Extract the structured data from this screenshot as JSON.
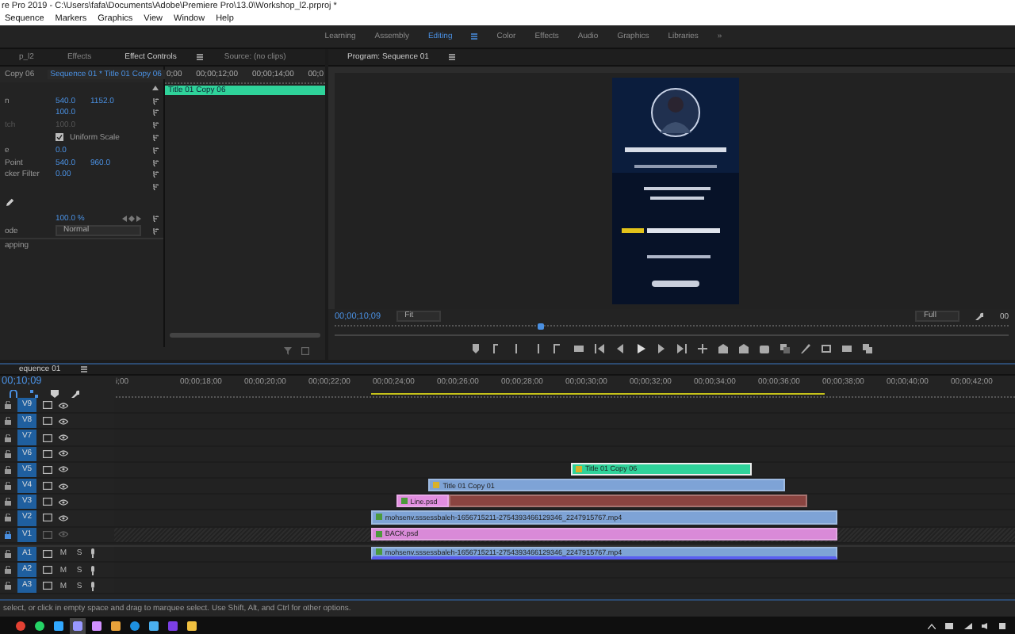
{
  "window": {
    "title": "re Pro 2019 - C:\\Users\\fafa\\Documents\\Adobe\\Premiere Pro\\13.0\\Workshop_l2.prproj *"
  },
  "menu": [
    "Sequence",
    "Markers",
    "Graphics",
    "View",
    "Window",
    "Help"
  ],
  "workspaces": [
    {
      "label": "Learning",
      "selected": false
    },
    {
      "label": "Assembly",
      "selected": false
    },
    {
      "label": "Editing",
      "selected": true
    },
    {
      "label": "Color",
      "selected": false
    },
    {
      "label": "Effects",
      "selected": false
    },
    {
      "label": "Audio",
      "selected": false
    },
    {
      "label": "Graphics",
      "selected": false
    },
    {
      "label": "Libraries",
      "selected": false
    }
  ],
  "workspace_more": "»",
  "effect_panel": {
    "tabs": [
      {
        "label": "p_l2",
        "selected": false
      },
      {
        "label": "Effects",
        "selected": false
      },
      {
        "label": "Effect Controls",
        "selected": true
      },
      {
        "label": "Source: (no clips)",
        "selected": false
      }
    ],
    "source_clip": "Copy 06",
    "sequence_clip": "Sequence 01 * Title 01 Copy 06",
    "ruler": [
      "0;00",
      "00;00;12;00",
      "00;00;14;00",
      "00;0"
    ],
    "clip": "Title 01 Copy 06",
    "properties": [
      {
        "kind": "value",
        "label": "n",
        "values": [
          "540.0",
          "1152.0"
        ],
        "disabled": false
      },
      {
        "kind": "value",
        "values": [
          "100.0"
        ],
        "disabled": false
      },
      {
        "kind": "value",
        "label": "tch",
        "values": [
          "100.0"
        ],
        "disabled": true
      },
      {
        "kind": "checkbox",
        "label": "Uniform Scale",
        "checked": true
      },
      {
        "kind": "value",
        "label": "e",
        "values": [
          "0.0"
        ],
        "disabled": false
      },
      {
        "kind": "value",
        "label": "Point",
        "values": [
          "540.0",
          "960.0"
        ],
        "disabled": false
      },
      {
        "kind": "value",
        "label": "cker Filter",
        "values": [
          "0.00"
        ],
        "disabled": false
      },
      {
        "kind": "blank"
      },
      {
        "kind": "pen"
      },
      {
        "kind": "value",
        "values": [
          "100.0 %"
        ],
        "disabled": false
      },
      {
        "kind": "dropdown",
        "label": "ode",
        "value": "Normal"
      },
      {
        "kind": "section",
        "label": "apping"
      }
    ]
  },
  "program": {
    "title": "Program: Sequence 01",
    "timecode": "00;00;10;09",
    "fit": "Fit",
    "quality": "Full",
    "cut_timecode": "00",
    "playhead": {
      "level": 0.3
    }
  },
  "timeline": {
    "title": "equence 01",
    "timecode": "00;10;09",
    "ruler": [
      "i;00",
      "00;00;18;00",
      "00;00;20;00",
      "00;00;22;00",
      "00;00;24;00",
      "00;00;26;00",
      "00;00;28;00",
      "00;00;30;00",
      "00;00;32;00",
      "00;00;34;00",
      "00;00;36;00",
      "00;00;38;00",
      "00;00;40;00",
      "00;00;42;00"
    ],
    "tracks": [
      {
        "name": "V9",
        "kind": "video",
        "locked": false
      },
      {
        "name": "V8",
        "kind": "video",
        "locked": false
      },
      {
        "name": "V7",
        "kind": "video",
        "locked": false
      },
      {
        "name": "V6",
        "kind": "video",
        "locked": false
      },
      {
        "name": "V5",
        "kind": "video",
        "locked": false,
        "clips": [
          {
            "label": "Title 01 Copy 06",
            "color": "#2fd39a"
          }
        ]
      },
      {
        "name": "V4",
        "kind": "video",
        "locked": false,
        "clips": [
          {
            "label": "Title 01 Copy 01",
            "color": "#7ea3d6"
          }
        ]
      },
      {
        "name": "V3",
        "kind": "video",
        "locked": false,
        "clips": [
          {
            "label": "Line.psd",
            "color": "#e28ee0"
          },
          {
            "color": "#8a4440"
          }
        ]
      },
      {
        "name": "V2",
        "kind": "video",
        "locked": false,
        "clips": [
          {
            "label": "mohsenv.sssessbaleh-1656715211-2754393466129346_2247915767.mp4",
            "color": "#7ea3d6"
          }
        ]
      },
      {
        "name": "V1",
        "kind": "video",
        "locked": true,
        "clips": [
          {
            "label": "BACK.psd",
            "color": "#d98ad8"
          }
        ]
      },
      {
        "name": "A1",
        "kind": "audio",
        "locked": false,
        "buttons": [
          "M",
          "S"
        ],
        "clips": [
          {
            "label": "mohsenv.sssessbaleh-1656715211-2754393466129346_2247915767.mp4",
            "color": "#7ea3d6"
          }
        ]
      },
      {
        "name": "A2",
        "kind": "audio",
        "locked": false,
        "buttons": [
          "M",
          "S"
        ]
      },
      {
        "name": "A3",
        "kind": "audio",
        "locked": false,
        "buttons": [
          "M",
          "S"
        ]
      }
    ]
  },
  "status_bar": "select, or click in empty space and drag to marquee select. Use Shift, Alt, and Ctrl for other options."
}
